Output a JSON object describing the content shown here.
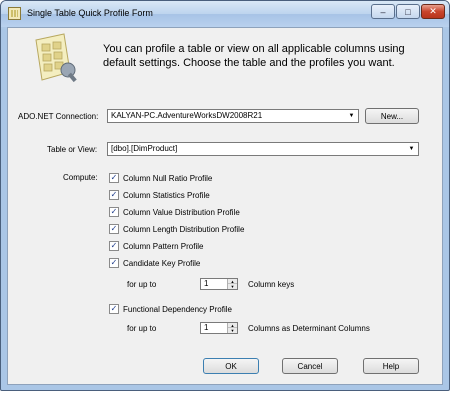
{
  "window": {
    "title": "Single Table Quick Profile Form"
  },
  "intro": {
    "text": "You can profile a table or view on all applicable columns using default settings. Choose the table and the profiles you want."
  },
  "connection": {
    "label": "ADO.NET Connection:",
    "value": "KALYAN-PC.AdventureWorksDW2008R21",
    "new_button": "New..."
  },
  "table": {
    "label": "Table or View:",
    "value": "[dbo].[DimProduct]"
  },
  "compute": {
    "label": "Compute:",
    "options": [
      {
        "label": "Column Null Ratio Profile",
        "checked": true
      },
      {
        "label": "Column Statistics Profile",
        "checked": true
      },
      {
        "label": "Column Value Distribution Profile",
        "checked": true
      },
      {
        "label": "Column Length Distribution Profile",
        "checked": true
      },
      {
        "label": "Column Pattern Profile",
        "checked": true
      },
      {
        "label": "Candidate Key Profile",
        "checked": true
      }
    ],
    "candidate_key": {
      "prefix": "for up to",
      "value": "1",
      "suffix": "Column keys"
    },
    "functional_dependency": {
      "label": "Functional Dependency Profile",
      "checked": true,
      "prefix": "for up to",
      "value": "1",
      "suffix": "Columns as Determinant Columns"
    }
  },
  "footer": {
    "ok": "OK",
    "cancel": "Cancel",
    "help": "Help"
  },
  "colors": {
    "titlebar": "#bdd4ee",
    "client_bg": "#f0f0f0",
    "close_button": "#c8442c",
    "checkmark": "#1b3a8a"
  },
  "icons": {
    "app": "profile-app-icon",
    "header": "table-profile-icon",
    "dropdown": "chevron-down-icon",
    "check": "checkmark-icon"
  }
}
